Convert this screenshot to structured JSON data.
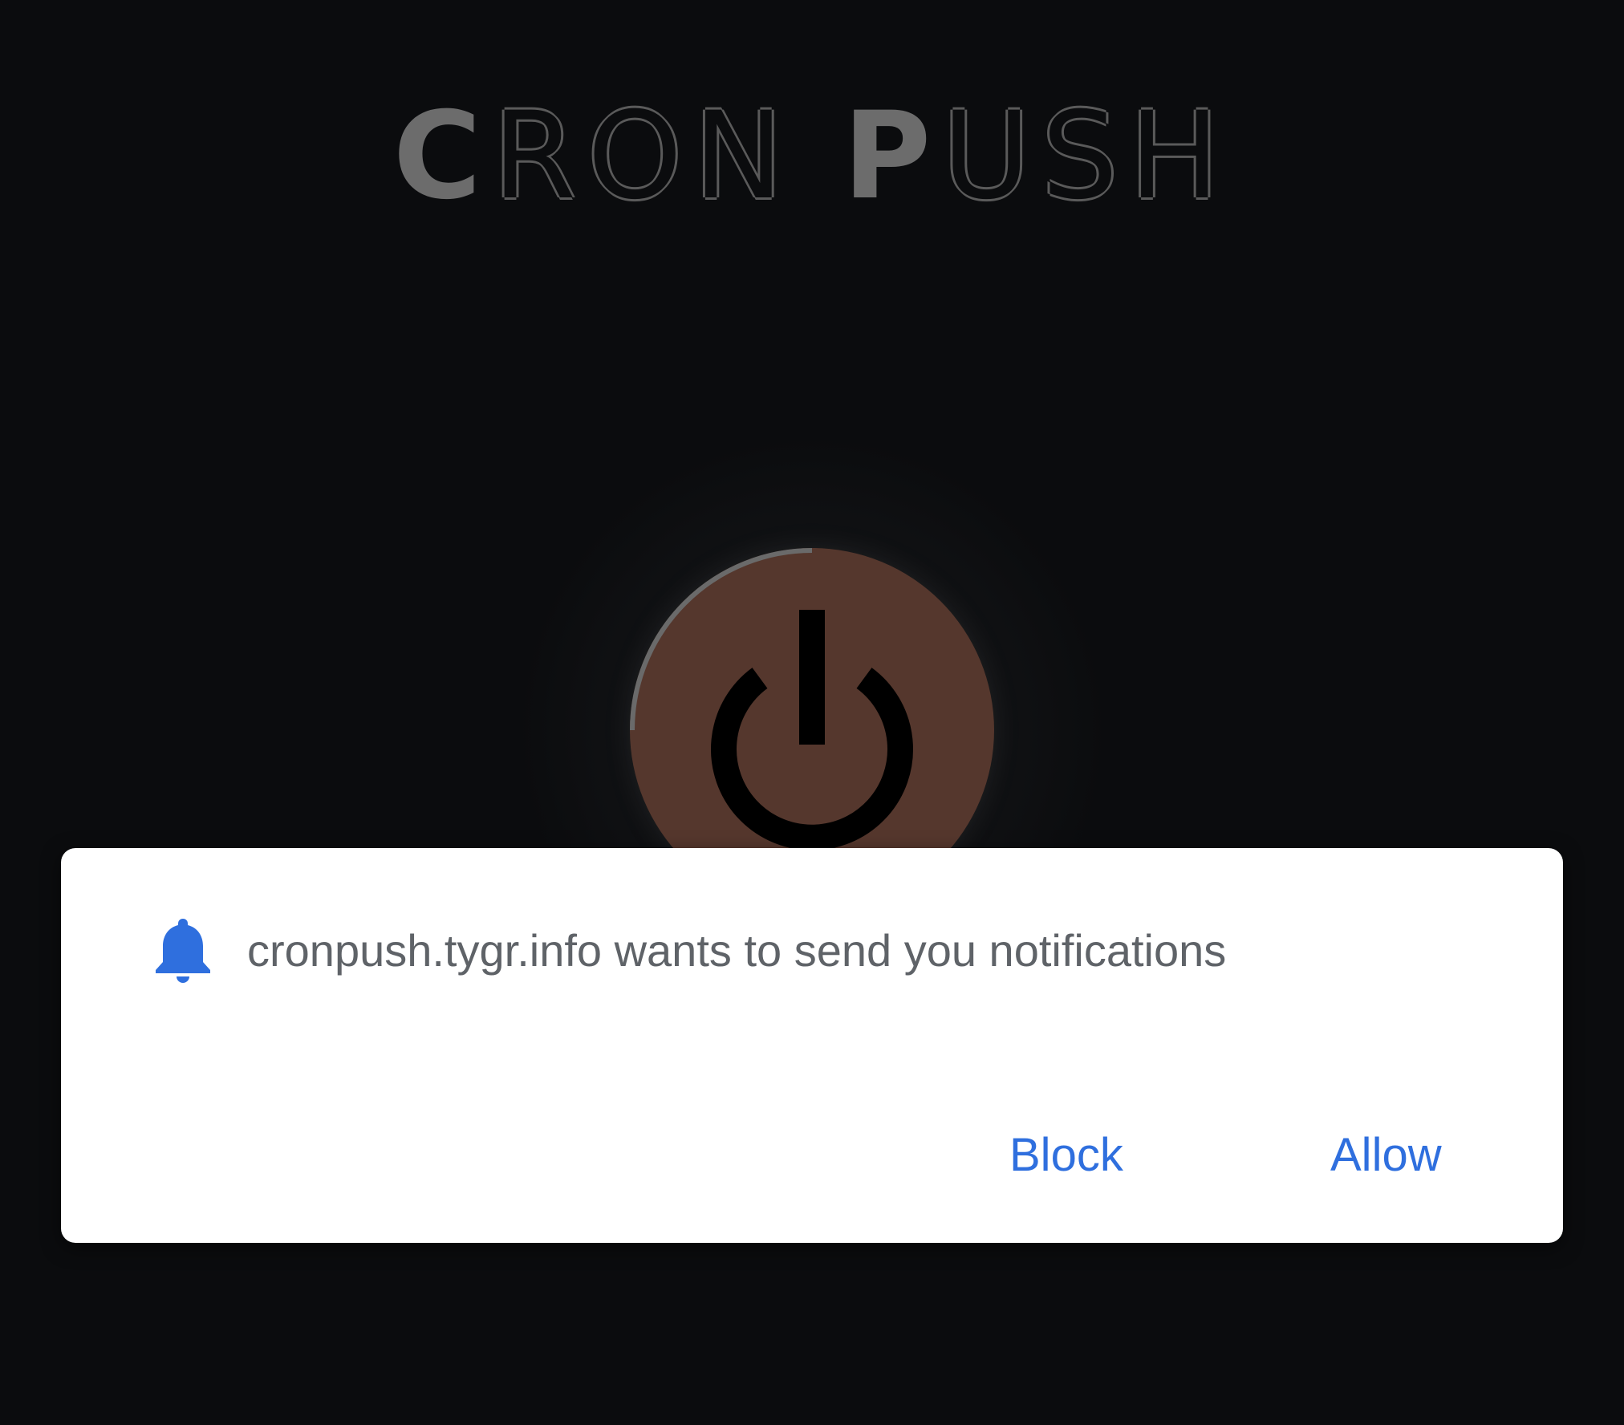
{
  "app": {
    "logo_lead_1": "C",
    "logo_rest_1": "RON",
    "logo_lead_2": "P",
    "logo_rest_2": "USH",
    "power_button": {
      "icon": "power-icon",
      "color": "#55372d"
    }
  },
  "notification_prompt": {
    "icon": "bell-icon",
    "message": "cronpush.tygr.info wants to send you notifications",
    "block_label": "Block",
    "allow_label": "Allow",
    "accent_color": "#2f6fde"
  }
}
